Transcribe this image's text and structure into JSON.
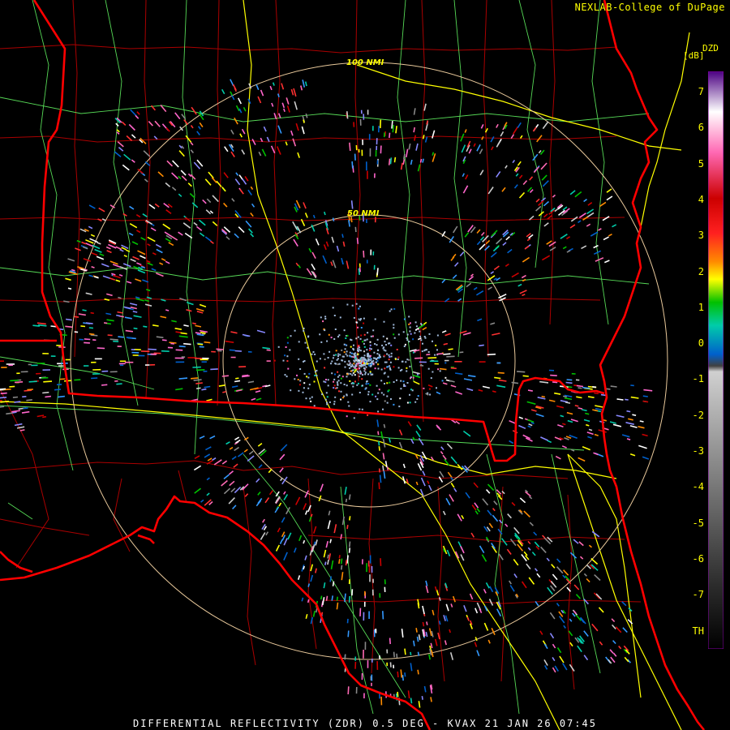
{
  "header": {
    "credit": "NEXLAB-College of DuPage"
  },
  "footer": {
    "title": "DIFFERENTIAL REFLECTIVITY (ZDR) 0.5 DEG - KVAX 21 JAN 26 07:45"
  },
  "range_rings": {
    "inner_label": "50 NMI",
    "outer_label": "100 NMI"
  },
  "legend": {
    "product": "DZD",
    "unit": "[dB]",
    "ticks": [
      "7",
      "6",
      "5",
      "4",
      "3",
      "2",
      "1",
      "0",
      "-1",
      "-2",
      "-3",
      "-4",
      "-5",
      "-6",
      "-7",
      "TH"
    ],
    "color_stops": [
      "#4b0082",
      "#ffffff",
      "#ff69b4",
      "#cc0000",
      "#ff2020",
      "#ff8c00",
      "#ffff00",
      "#00c000",
      "#00ccaa",
      "#0060cc",
      "#404040",
      "#d0d0d0",
      "#808080",
      "#303030",
      "#000000"
    ]
  },
  "colors": {
    "state_boundary": "#ff0000",
    "county_boundary": "#aa0000",
    "interstate": "#ffff00",
    "highway": "#66ff66",
    "range_ring": "#e8c89a",
    "text": "#ffff00"
  }
}
